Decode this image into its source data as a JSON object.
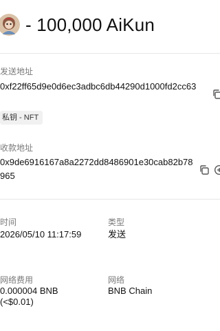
{
  "header": {
    "amount_text": "- 100,000 AiKun"
  },
  "sender": {
    "label": "发送地址",
    "address": "0xf22ff65d9e0d6ec3adbc6db44290d1000fd2cc63",
    "tag": "私钥 - NFT"
  },
  "receiver": {
    "label": "收款地址",
    "address": "0x9de6916167a8a2272dd8486901e30cab82b78965"
  },
  "details": {
    "time_label": "时间",
    "time_value": "2026/05/10 11:17:59",
    "type_label": "类型",
    "type_value": "发送",
    "fee_label": "网络费用",
    "fee_value_line1": "0.000004 BNB",
    "fee_value_line2": "(<$0.01)",
    "network_label": "网络",
    "network_value": "BNB Chain"
  }
}
